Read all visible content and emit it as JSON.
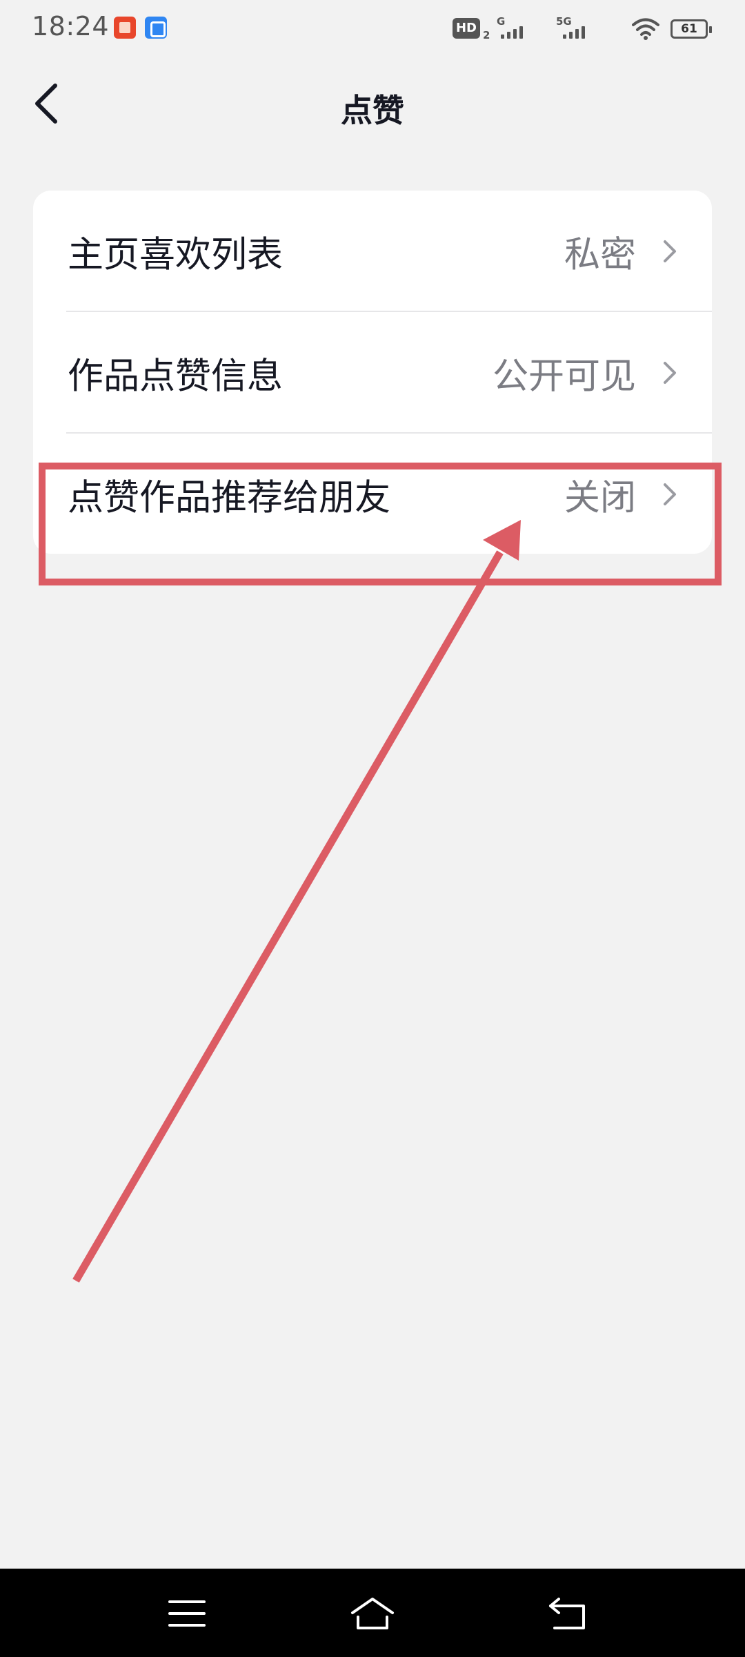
{
  "status_bar": {
    "time": "18:24",
    "network_badge": "HD",
    "network_sub": "2",
    "signal_1_label": "G",
    "signal_2_label": "5G",
    "battery": "61"
  },
  "header": {
    "title": "点赞",
    "back_icon": "chevron-left-icon"
  },
  "settings": [
    {
      "label": "主页喜欢列表",
      "value": "私密"
    },
    {
      "label": "作品点赞信息",
      "value": "公开可见"
    },
    {
      "label": "点赞作品推荐给朋友",
      "value": "关闭"
    }
  ],
  "colors": {
    "background": "#f2f2f2",
    "card": "#ffffff",
    "annotation": "#dc5c64",
    "value_text": "#7b7c83"
  },
  "nav_bar": {
    "menu_icon": "menu-icon",
    "home_icon": "home-icon",
    "back_icon": "back-icon"
  }
}
